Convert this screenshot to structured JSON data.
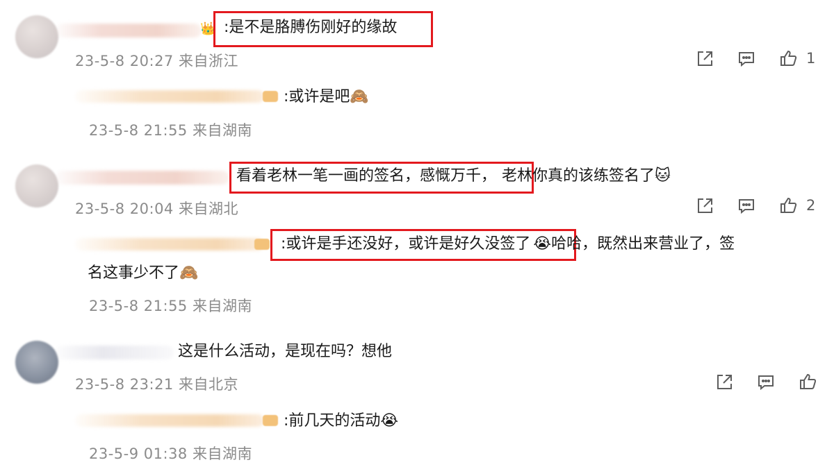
{
  "comments": [
    {
      "text": ":是不是胳膊伤刚好的缘故",
      "time": "23-5-8 20:27",
      "location": "来自浙江",
      "like_count": "1",
      "reply": {
        "text": ":或许是吧",
        "emoji": "🙈",
        "time": "23-5-8 21:55",
        "location": "来自湖南"
      }
    },
    {
      "text_highlighted": "看着老林一笔一画的签名，感慨万千，",
      "text_rest": "老林你真的该练签名了",
      "emoji": "🐱",
      "time": "23-5-8 20:04",
      "location": "来自湖北",
      "like_count": "2",
      "reply": {
        "text_highlighted": ":或许是手还没好，或许是好久没签了",
        "emoji": "😭",
        "text_rest": "哈哈，既然出来营业了，签",
        "text_line2": "名这事少不了",
        "emoji2": "🙈",
        "time": "23-5-8 21:55",
        "location": "来自湖南"
      }
    },
    {
      "text": "这是什么活动，是现在吗？想他",
      "time": "23-5-8 23:21",
      "location": "来自北京",
      "like_count": "",
      "reply": {
        "text": ":前几天的活动",
        "emoji": "😭",
        "time": "23-5-9 01:38",
        "location": "来自湖南"
      }
    }
  ],
  "icons": {
    "share": "share-icon",
    "comment": "comment-icon",
    "like": "thumbs-up-icon"
  },
  "colors": {
    "highlight_border": "#e3191e",
    "meta_text": "#8b8b8b"
  }
}
